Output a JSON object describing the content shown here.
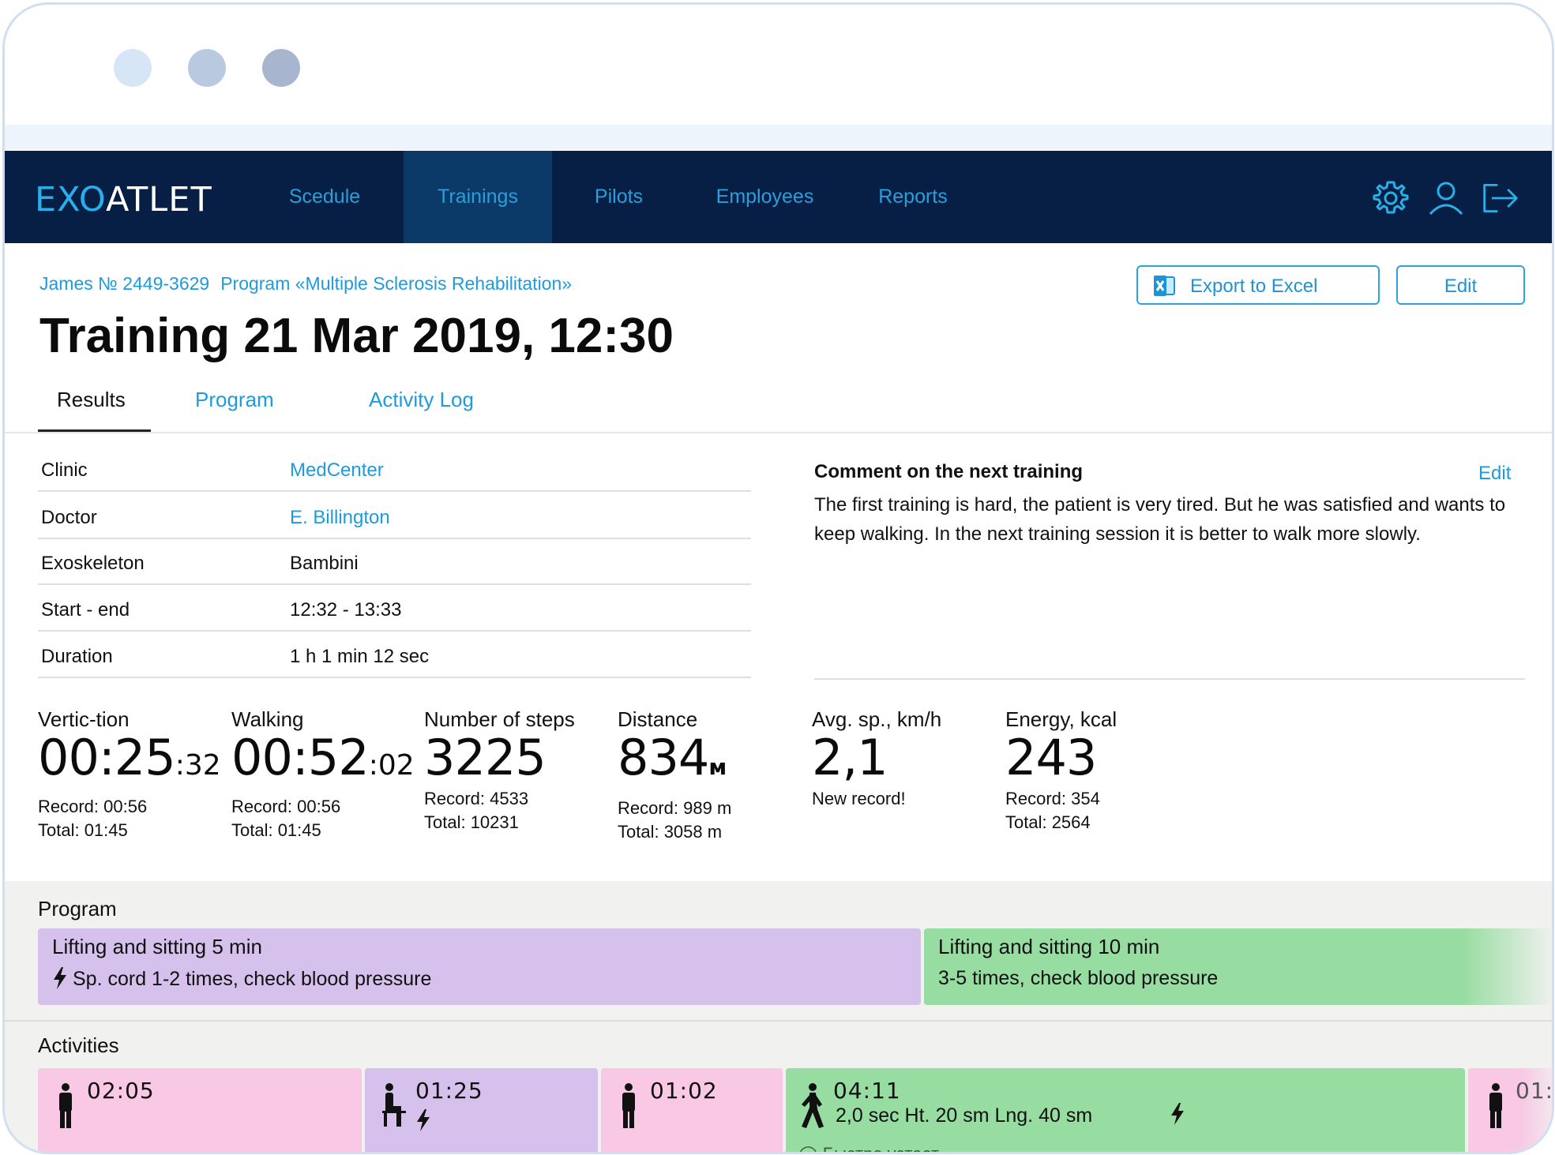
{
  "window": {
    "dot_colors": [
      "#d6e6f7",
      "#b8c9e0",
      "#a7b6ce"
    ]
  },
  "nav": {
    "logo_exo": "EXO",
    "logo_atlet": "ATLET",
    "items": [
      "Scedule",
      "Trainings",
      "Pilots",
      "Employees",
      "Reports"
    ],
    "active": "Trainings",
    "icons": [
      "gear-icon",
      "user-icon",
      "logout-icon"
    ]
  },
  "header": {
    "patient": "James № 2449-3629",
    "program": "Program «Multiple Sclerosis Rehabilitation»",
    "title": "Training 21 Mar 2019, 12:30",
    "export_label": "Export to Excel",
    "edit_label": "Edit"
  },
  "tabs": [
    "Results",
    "Program",
    "Activity Log"
  ],
  "info": [
    {
      "key": "Clinic",
      "value": "MedCenter"
    },
    {
      "key": "Doctor",
      "value": "E. Billington"
    },
    {
      "key": "Exoskeleton",
      "value": "Bambini"
    },
    {
      "key": "Start - end",
      "value": "12:32 - 13:33"
    },
    {
      "key": "Duration",
      "value": "1 h 1 min 12 sec"
    }
  ],
  "comment": {
    "heading": "Comment on the next training",
    "edit": "Edit",
    "text": "The first training is hard, the patient is very tired. But he was satisfied and wants to keep walking. In the next training session it is better to walk more slowly."
  },
  "stats": [
    {
      "label": "Vertic-tion",
      "main": "00:25",
      "small": ":32",
      "record": "Record: 00:56",
      "total": "Total: 01:45"
    },
    {
      "label": "Walking",
      "main": "00:52",
      "small": ":02",
      "record": "Record: 00:56",
      "total": "Total: 01:45"
    },
    {
      "label": "Number of steps",
      "main": "3225",
      "record": "Record: 4533",
      "total": "Total: 10231"
    },
    {
      "label": "Distance",
      "main": "834",
      "unit": "м",
      "record": "Record: 989 m",
      "total": "Total: 3058 m"
    },
    {
      "label": "Avg. sp., km/h",
      "main": "2,1",
      "record": "New record!"
    },
    {
      "label": "Energy, kcal",
      "main": "243",
      "record": "Record: 354",
      "total": "Total: 2564"
    }
  ],
  "program_section": {
    "label": "Program",
    "blocks": [
      {
        "title": "Lifting and sitting 5 min",
        "desc": "Sp. cord 1-2 times, check blood pressure",
        "color": "#d6c0ec"
      },
      {
        "title": "Lifting and sitting 10 min",
        "desc": "3-5 times, check blood pressure",
        "color": "#97dca0"
      }
    ]
  },
  "activities_section": {
    "label": "Activities",
    "blocks": [
      {
        "time": "02:05",
        "color": "#f8c8e4"
      },
      {
        "time": "01:25",
        "color": "#d6c0ec"
      },
      {
        "time": "01:02",
        "color": "#f8c8e4"
      },
      {
        "time": "04:11",
        "detail": "2,0 sec Ht. 20 sm Lng. 40 sm",
        "note": "Быстро устает",
        "color": "#97dca0"
      },
      {
        "time": "01:",
        "color": "#f8c8e4"
      }
    ]
  }
}
